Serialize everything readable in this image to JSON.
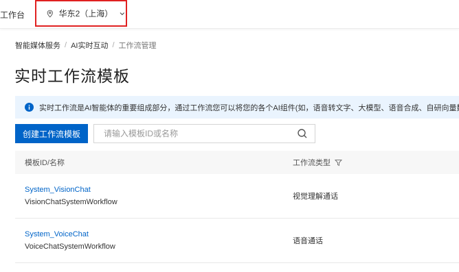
{
  "topbar": {
    "workbench_label": "工作台",
    "region_label": "华东2（上海）"
  },
  "breadcrumb": {
    "items": [
      "智能媒体服务",
      "AI实时互动",
      "工作流管理"
    ],
    "separator": "/"
  },
  "page": {
    "title": "实时工作流模板"
  },
  "notice": {
    "text": "实时工作流是AI智能体的重要组成部分，通过工作流您可以将您的各个AI组件(如，语音转文字、大模型、语音合成、自研向量数据"
  },
  "toolbar": {
    "create_label": "创建工作流模板",
    "search_placeholder": "请输入模板ID或名称"
  },
  "table": {
    "columns": [
      "模板ID/名称",
      "工作流类型"
    ],
    "rows": [
      {
        "id": "System_VisionChat",
        "name": "VisionChatSystemWorkflow",
        "type": "视觉理解通话"
      },
      {
        "id": "System_VoiceChat",
        "name": "VoiceChatSystemWorkflow",
        "type": "语音通话"
      }
    ]
  },
  "colors": {
    "primary": "#0064c8",
    "notice_bg": "#eaf4fe",
    "highlight_border": "#e02020"
  },
  "icons": [
    "location-pin-icon",
    "chevron-down-icon",
    "info-icon",
    "search-icon",
    "filter-icon"
  ]
}
